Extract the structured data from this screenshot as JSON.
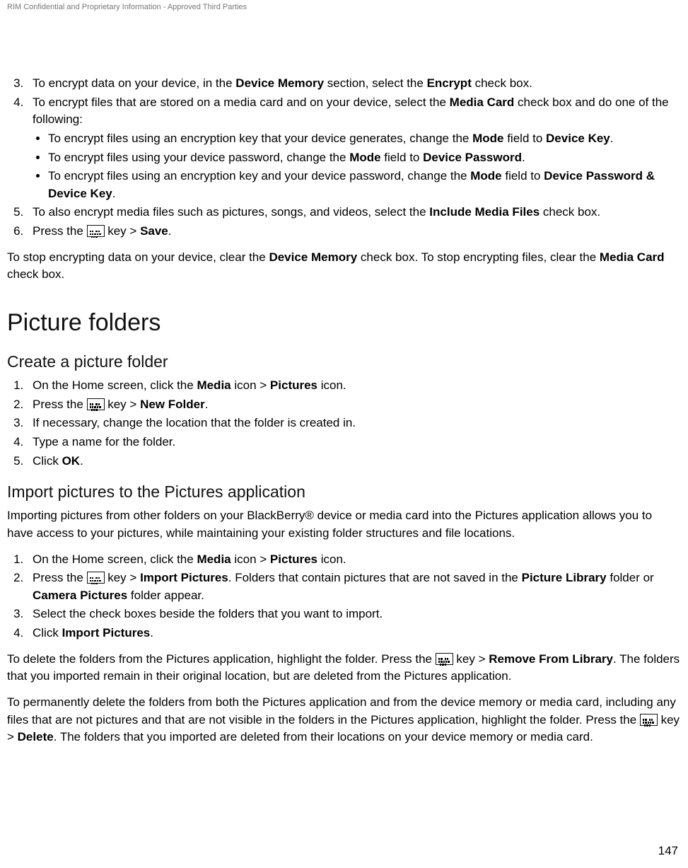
{
  "header": {
    "confidential": "RIM Confidential and Proprietary Information - Approved Third Parties"
  },
  "steps_top": {
    "s3_a": "To encrypt data on your device, in the ",
    "bold_dev_mem": "Device Memory",
    "s3_b": " section, select the ",
    "bold_encrypt": "Encrypt",
    "s3_c": " check box.",
    "s4_a": "To encrypt files that are stored on a media card and on your device, select the ",
    "bold_media_card": "Media Card",
    "s4_b": " check box and do one of the following:",
    "b1_a": "To encrypt files using an encryption key that your device generates, change the ",
    "bold_mode": "Mode",
    "b1_b": " field to ",
    "bold_devkey": "Device Key",
    "period": ".",
    "b2_a": "To encrypt files using your device password, change the ",
    "b2_b": " field to ",
    "bold_devpass": "Device Password",
    "b3_a": "To encrypt files using an encryption key and your device password, change the ",
    "b3_b": " field to ",
    "bold_devpasskey": "Device Password & Device Key",
    "s5_a": "To also encrypt media files such as pictures, songs, and videos, select the ",
    "bold_include_media": "Include Media Files",
    "s5_b": " check box.",
    "s6_a": "Press the ",
    "s6_b": " key > ",
    "bold_save": "Save"
  },
  "para_stop": {
    "a": "To stop encrypting data on your device, clear the ",
    "bold_dev_mem2": "Device Memory",
    "b": " check box. To stop encrypting files, clear the ",
    "bold_media_card2": "Media Card",
    "c": " check box."
  },
  "sections": {
    "picture_folders": "Picture folders",
    "create_folder": "Create a picture folder",
    "import_pictures": "Import pictures to the Pictures application"
  },
  "create_steps": {
    "s1_a": "On the Home screen, click the ",
    "bold_media": "Media",
    "s1_b": " icon > ",
    "bold_pictures": "Pictures",
    "s1_c": " icon.",
    "s2_a": "Press the ",
    "s2_b": " key > ",
    "bold_newfolder": "New Folder",
    "period": ".",
    "s3": "If necessary, change the location that the folder is created in.",
    "s4": "Type a name for the folder.",
    "s5_a": "Click ",
    "bold_ok": "OK"
  },
  "import_intro": "Importing pictures from other folders on your BlackBerry® device or media card into the Pictures application allows you to have access to your pictures, while maintaining your existing folder structures and file locations.",
  "import_steps": {
    "s1_a": "On the Home screen, click the ",
    "bold_media": "Media",
    "s1_b": " icon > ",
    "bold_pictures": "Pictures",
    "s1_c": " icon.",
    "s2_a": "Press the ",
    "s2_b": " key > ",
    "bold_import": "Import Pictures",
    "s2_c": ". Folders that contain pictures that are not saved in the ",
    "bold_piclib": "Picture Library",
    "s2_d": " folder or ",
    "bold_campics": "Camera Pictures",
    "s2_e": " folder appear.",
    "s3": "Select the check boxes beside the folders that you want to import.",
    "s4_a": "Click ",
    "bold_import2": "Import Pictures",
    "period": "."
  },
  "para_delete": {
    "a": "To delete the folders from the Pictures application, highlight the folder. Press the ",
    "b": " key > ",
    "bold_remove": "Remove From Library",
    "c": ". The folders that you imported remain in their original location, but are deleted from the Pictures application."
  },
  "para_perm_delete": {
    "a": "To permanently delete the folders from both the Pictures application and from the device memory or media card, including any files that are not pictures and that are not visible in the folders in the Pictures application, highlight the folder. Press the ",
    "b": " key > ",
    "bold_delete": "Delete",
    "c": ". The folders that you imported are deleted from their locations on your device memory or media card."
  },
  "page_number": "147",
  "icons": {
    "menu_key": "menu-key-icon"
  }
}
